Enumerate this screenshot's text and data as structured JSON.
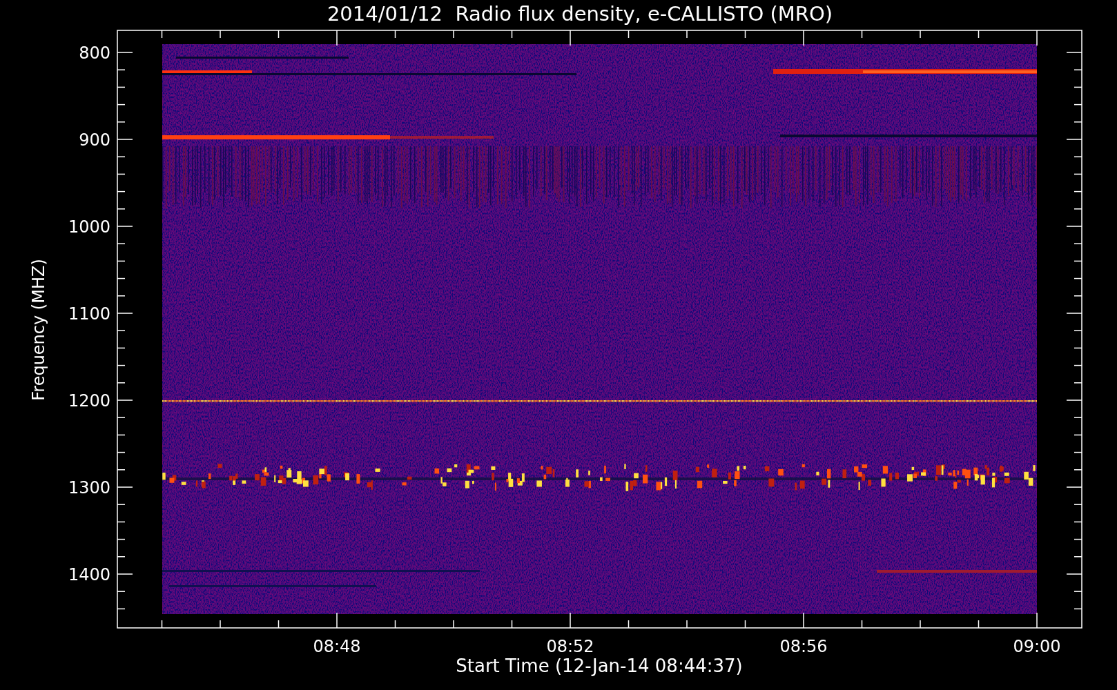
{
  "title": "2014/01/12  Radio flux density, e-CALLISTO (MRO)",
  "y_axis": {
    "label": "Frequency (MHZ)",
    "ticks": [
      "800",
      "900",
      "1000",
      "1100",
      "1200",
      "1300",
      "1400"
    ]
  },
  "x_axis": {
    "label": "Start Time (12-Jan-14 08:44:37)",
    "ticks": [
      "08:48",
      "08:52",
      "08:56",
      "09:00"
    ]
  }
}
